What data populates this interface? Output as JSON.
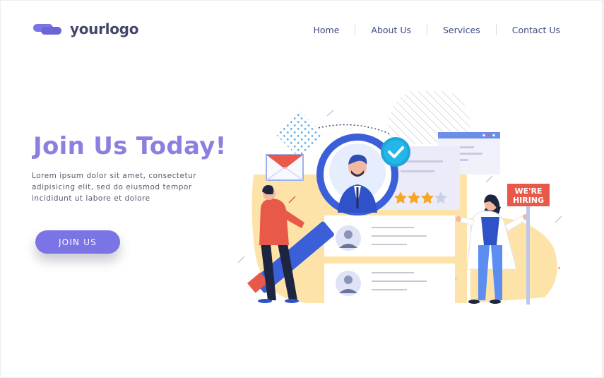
{
  "brand": {
    "logo_text": "yourlogo",
    "logo_icon": "cloud-logo-icon"
  },
  "nav": {
    "items": [
      {
        "label": "Home"
      },
      {
        "label": "About Us"
      },
      {
        "label": "Services"
      },
      {
        "label": "Contact Us"
      }
    ]
  },
  "hero": {
    "title": "Join Us Today!",
    "text_lines": [
      "Lorem ipsum dolor sit amet, consectetur",
      "adipisicing elit, sed do eiusmod tempor",
      "incididunt ut labore et dolore"
    ],
    "cta_label": "JOIN US"
  },
  "illustration": {
    "sign_lines": [
      "WE'RE",
      "HIRING"
    ],
    "rating_stars": 4,
    "rating_max": 5
  },
  "colors": {
    "accent": "#7b74e4",
    "title": "#8a80e0",
    "nav_text": "#3f4a83",
    "illustration_yellow": "#fde3a8",
    "illustration_blue": "#3b5fd8",
    "illustration_red": "#e8594a",
    "star": "#f6a623"
  }
}
